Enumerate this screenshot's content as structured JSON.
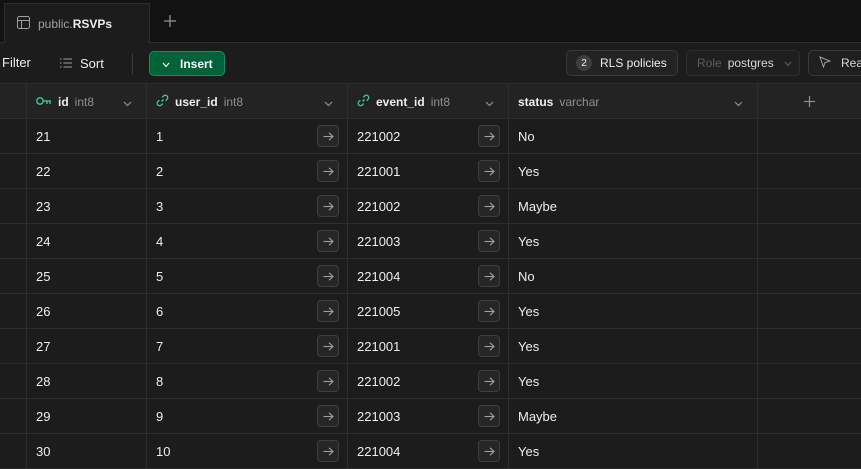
{
  "tab": {
    "schema": "public.",
    "table": "RSVPs"
  },
  "toolbar": {
    "filter_label": "Filter",
    "sort_label": "Sort",
    "insert_label": "Insert",
    "rls_count": "2",
    "rls_label": "RLS policies",
    "role_key": "Role",
    "role_value": "postgres",
    "read_label": "Rea"
  },
  "columns": [
    {
      "name": "id",
      "type": "int8"
    },
    {
      "name": "user_id",
      "type": "int8"
    },
    {
      "name": "event_id",
      "type": "int8"
    },
    {
      "name": "status",
      "type": "varchar"
    }
  ],
  "rows": [
    {
      "id": "21",
      "user_id": "1",
      "event_id": "221002",
      "status": "No"
    },
    {
      "id": "22",
      "user_id": "2",
      "event_id": "221001",
      "status": "Yes"
    },
    {
      "id": "23",
      "user_id": "3",
      "event_id": "221002",
      "status": "Maybe"
    },
    {
      "id": "24",
      "user_id": "4",
      "event_id": "221003",
      "status": "Yes"
    },
    {
      "id": "25",
      "user_id": "5",
      "event_id": "221004",
      "status": "No"
    },
    {
      "id": "26",
      "user_id": "6",
      "event_id": "221005",
      "status": "Yes"
    },
    {
      "id": "27",
      "user_id": "7",
      "event_id": "221001",
      "status": "Yes"
    },
    {
      "id": "28",
      "user_id": "8",
      "event_id": "221002",
      "status": "Yes"
    },
    {
      "id": "29",
      "user_id": "9",
      "event_id": "221003",
      "status": "Maybe"
    },
    {
      "id": "30",
      "user_id": "10",
      "event_id": "221004",
      "status": "Yes"
    }
  ],
  "colors": {
    "accent": "#3ecf8e",
    "insert_bg": "#006239",
    "background": "#1c1c1c"
  },
  "icons": [
    "table-icon",
    "plus-icon",
    "sort-icon",
    "chevron-down-icon",
    "key-icon",
    "link-icon",
    "arrow-right-icon",
    "cursor-icon"
  ]
}
